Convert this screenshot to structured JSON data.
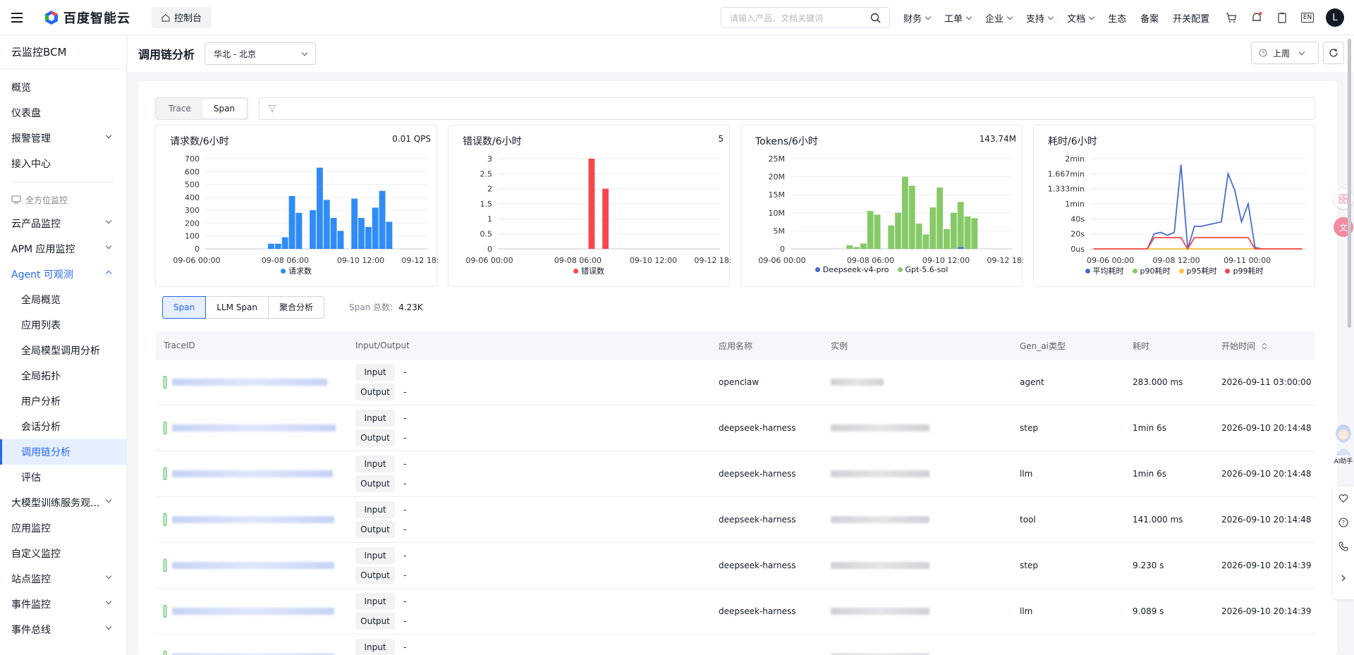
{
  "topbar": {
    "logo_text": "百度智能云",
    "console_label": "控制台",
    "search_placeholder": "请输入产品、文档关键词",
    "nav": [
      {
        "label": "财务",
        "dropdown": true
      },
      {
        "label": "工单",
        "dropdown": true
      },
      {
        "label": "企业",
        "dropdown": true
      },
      {
        "label": "支持",
        "dropdown": true
      },
      {
        "label": "文档",
        "dropdown": true
      },
      {
        "label": "生态",
        "dropdown": false
      },
      {
        "label": "备案",
        "dropdown": false
      },
      {
        "label": "开关配置",
        "dropdown": false
      }
    ],
    "lang": "EN",
    "avatar": "L"
  },
  "sidebar": {
    "title": "云监控BCM",
    "top_items": [
      "概览",
      "仪表盘",
      "报警管理",
      "接入中心"
    ],
    "group_label": "全方位监控",
    "items": [
      {
        "label": "云产品监控",
        "expand": "down"
      },
      {
        "label": "APM 应用监控",
        "expand": "down"
      },
      {
        "label": "Agent 可观测",
        "expand": "up",
        "open": true
      }
    ],
    "sub_items": [
      "全局概览",
      "应用列表",
      "全局模型调用分析",
      "全局拓扑",
      "用户分析",
      "会话分析",
      "调用链分析",
      "评估"
    ],
    "active_sub": "调用链分析",
    "bottom_items": [
      {
        "label": "大模型训练服务观...",
        "expand": "down"
      },
      {
        "label": "应用监控",
        "expand": ""
      },
      {
        "label": "自定义监控",
        "expand": ""
      },
      {
        "label": "站点监控",
        "expand": "down"
      },
      {
        "label": "事件监控",
        "expand": "down"
      },
      {
        "label": "事件总线",
        "expand": "down"
      }
    ]
  },
  "header": {
    "title": "调用链分析",
    "region": "华北 - 北京",
    "time_range": "上周"
  },
  "mode_tabs": [
    "Trace",
    "Span"
  ],
  "mode_active": "Span",
  "charts": [
    {
      "title": "请求数/6小时",
      "value": "0.01 QPS",
      "chart_data": {
        "type": "bar",
        "title": "请求数/6小时",
        "y_ticks": [
          "700",
          "600",
          "500",
          "400",
          "300",
          "200",
          "100",
          "0"
        ],
        "ylim": [
          0,
          700
        ],
        "x_ticks": [
          "09-06 00:00",
          "09-08 06:00",
          "09-10 12:00",
          "09-12 18:"
        ],
        "series": [
          {
            "name": "请求数",
            "color": "#2f8cf7",
            "values": [
              0,
              0,
              0,
              0,
              0,
              0,
              0,
              0,
              0,
              40,
              40,
              90,
              410,
              280,
              0,
              300,
              630,
              380,
              240,
              140,
              0,
              390,
              240,
              170,
              320,
              450,
              210,
              0,
              0,
              0,
              0,
              0
            ]
          }
        ]
      }
    },
    {
      "title": "错误数/6小时",
      "value": "5",
      "chart_data": {
        "type": "bar",
        "title": "错误数/6小时",
        "y_ticks": [
          "3",
          "2.5",
          "2",
          "1.5",
          "1",
          "0.5",
          "0"
        ],
        "ylim": [
          0,
          3
        ],
        "x_ticks": [
          "09-06 00:00",
          "09-08 06:00",
          "09-10 12:00",
          "09-12 18:"
        ],
        "series": [
          {
            "name": "错误数",
            "color": "#f5484c",
            "values": [
              0,
              0,
              0,
              0,
              0,
              0,
              0,
              0,
              0,
              0,
              0,
              0,
              0,
              3,
              0,
              2,
              0,
              0,
              0,
              0,
              0,
              0,
              0,
              0,
              0,
              0,
              0,
              0,
              0,
              0,
              0,
              0
            ]
          }
        ]
      }
    },
    {
      "title": "Tokens/6小时",
      "value": "143.74M",
      "chart_data": {
        "type": "bar",
        "title": "Tokens/6小时",
        "y_ticks": [
          "25M",
          "20M",
          "15M",
          "10M",
          "5M",
          "0"
        ],
        "ylim": [
          0,
          25
        ],
        "x_ticks": [
          "09-06 00:00",
          "09-08 06:00",
          "09-10 12:00",
          "09-12 18:"
        ],
        "series": [
          {
            "name": "Deepseek-v4-pro",
            "color": "#4b6bd1",
            "values": [
              0,
              0,
              0,
              0,
              0,
              0,
              0,
              0,
              0,
              0,
              0,
              0,
              0,
              0,
              0,
              0,
              0,
              0,
              0,
              0,
              0,
              0,
              0,
              0,
              0.5,
              0,
              0,
              0,
              0,
              0,
              0,
              0
            ]
          },
          {
            "name": "Gpt-5.6-sol",
            "color": "#86ca68",
            "values": [
              0,
              0,
              0,
              0,
              0,
              0,
              0,
              0,
              1,
              0.5,
              1.5,
              10.5,
              9.5,
              0,
              6.5,
              10,
              20,
              17.5,
              7,
              4,
              11.5,
              17,
              5.5,
              10,
              12.5,
              9,
              8.5,
              0,
              0,
              0,
              0,
              0
            ]
          }
        ]
      }
    },
    {
      "title": "耗时/6小时",
      "value": "",
      "chart_data": {
        "type": "line",
        "title": "耗时/6小时",
        "y_ticks": [
          "2min",
          "1.667min",
          "1.333min",
          "1min",
          "40s",
          "20s",
          "0us"
        ],
        "ylim": [
          0,
          120
        ],
        "x_ticks": [
          "09-06 00:00",
          "09-08 12:00",
          "09-11 00:00"
        ],
        "series": [
          {
            "name": "平均耗时",
            "color": "#4b6bd1",
            "values": [
              0,
              0,
              0,
              0,
              0,
              0,
              0,
              0,
              0,
              20,
              22,
              18,
              22,
              112,
              0,
              30,
              30,
              32,
              34,
              36,
              100,
              78,
              36,
              60,
              2,
              0,
              0,
              0,
              0,
              0,
              0,
              0
            ]
          },
          {
            "name": "p90耗时",
            "color": "#86ca68",
            "values": [
              0,
              0,
              0,
              0,
              0,
              0,
              0,
              0,
              0,
              0,
              0,
              0,
              0,
              0,
              0,
              0,
              0,
              0,
              0,
              0,
              0,
              0,
              0,
              0,
              0,
              0,
              0,
              0,
              0,
              0,
              0,
              0
            ]
          },
          {
            "name": "p95耗时",
            "color": "#f6c443",
            "values": [
              0,
              0,
              0,
              0,
              0,
              0,
              0,
              0,
              0,
              0,
              0,
              0,
              0,
              0,
              0,
              0,
              0,
              0,
              0,
              0,
              0,
              0,
              0,
              0,
              0,
              0,
              0,
              0,
              0,
              0,
              0,
              0
            ]
          },
          {
            "name": "p99耗时",
            "color": "#f5484c",
            "values": [
              0,
              0,
              0,
              0,
              0,
              0,
              0,
              0,
              0,
              15,
              15,
              15,
              15,
              15,
              0,
              15,
              15,
              15,
              15,
              15,
              15,
              15,
              15,
              15,
              0,
              0,
              0,
              0,
              0,
              0,
              0,
              0
            ]
          }
        ]
      }
    }
  ],
  "span_tabs": [
    "Span",
    "LLM Span",
    "聚合分析"
  ],
  "span_active": "Span",
  "span_total_label": "Span 总数:",
  "span_total_value": "4.23K",
  "table": {
    "columns": [
      "TraceID",
      "Input/Output",
      "应用名称",
      "实例",
      "Gen_ai类型",
      "耗时",
      "开始时间"
    ],
    "input_label": "Input",
    "output_label": "Output",
    "dash": "-",
    "rows": [
      {
        "app": "openclaw",
        "type": "agent",
        "duration": "283.000 ms",
        "start": "2026-09-11 03:00:00"
      },
      {
        "app": "deepseek-harness",
        "type": "step",
        "duration": "1min 6s",
        "start": "2026-09-10 20:14:48"
      },
      {
        "app": "deepseek-harness",
        "type": "llm",
        "duration": "1min 6s",
        "start": "2026-09-10 20:14:48"
      },
      {
        "app": "deepseek-harness",
        "type": "tool",
        "duration": "141.000 ms",
        "start": "2026-09-10 20:14:48"
      },
      {
        "app": "deepseek-harness",
        "type": "step",
        "duration": "9.230 s",
        "start": "2026-09-10 20:14:39"
      },
      {
        "app": "deepseek-harness",
        "type": "llm",
        "duration": "9.089 s",
        "start": "2026-09-10 20:14:39"
      },
      {
        "app": "",
        "type": "",
        "duration": "",
        "start": ""
      }
    ]
  },
  "assistant_label": "AI助手"
}
